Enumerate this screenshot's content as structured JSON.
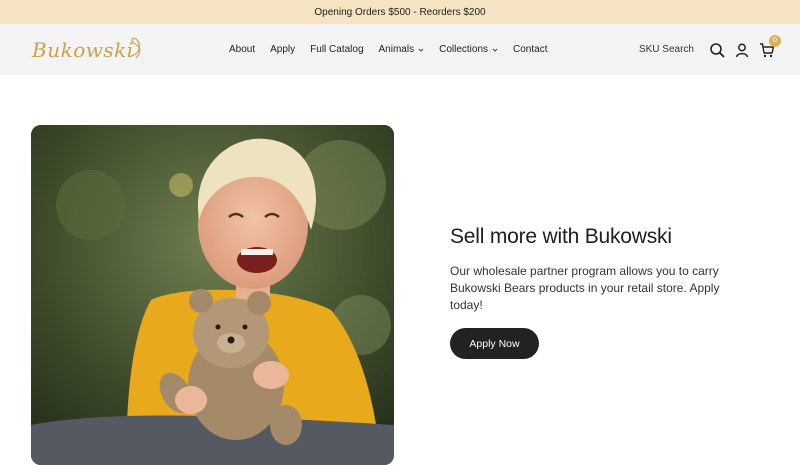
{
  "announcement": {
    "text": "Opening Orders $500 - Reorders $200"
  },
  "header": {
    "logo_text": "Bukowski",
    "nav": [
      {
        "label": "About"
      },
      {
        "label": "Apply"
      },
      {
        "label": "Full Catalog"
      },
      {
        "label": "Animals"
      },
      {
        "label": "Collections"
      },
      {
        "label": "Contact"
      }
    ],
    "sku_search_label": "SKU Search",
    "cart_count": "0"
  },
  "hero": {
    "title": "Sell more with Bukowski",
    "description": "Our wholesale partner program allows you to carry Bukowski Bears products in your retail store. Apply today!",
    "cta_label": "Apply Now"
  },
  "colors": {
    "announcement_bg": "#f5e3c1",
    "header_bg": "#f4f4f4",
    "brand_gold": "#c9a24a",
    "button_dark": "#222222"
  }
}
